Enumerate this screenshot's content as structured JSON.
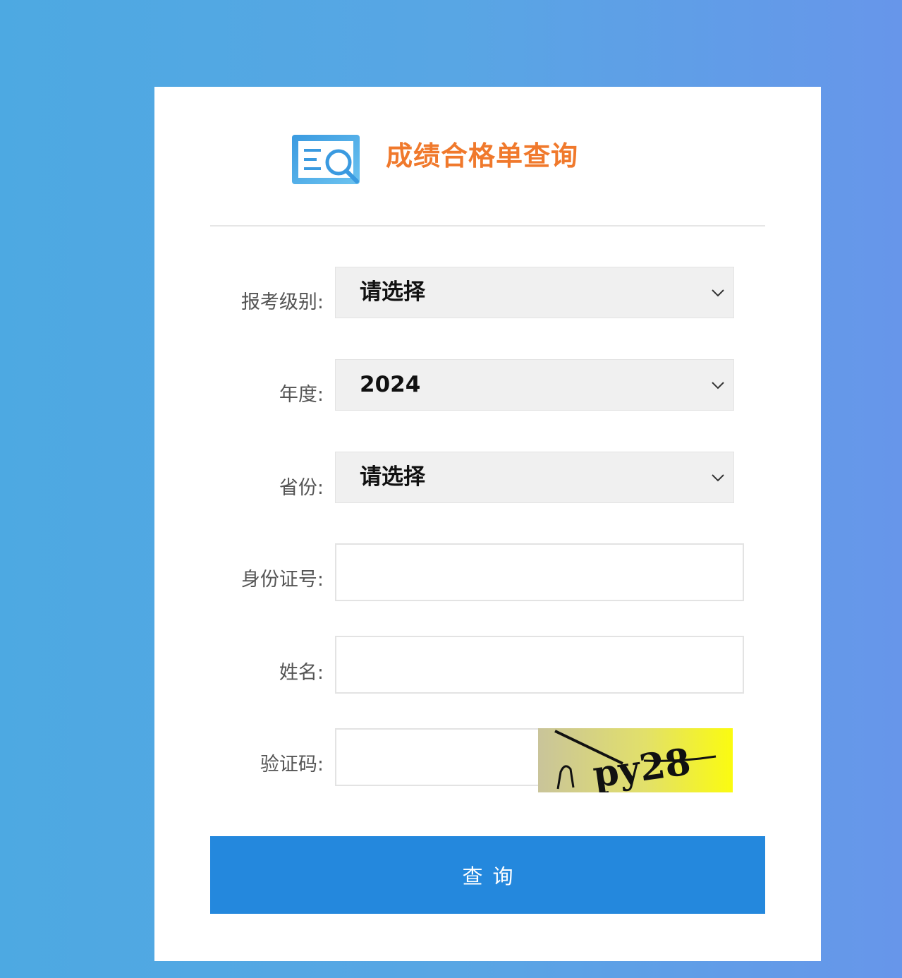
{
  "header": {
    "title": "成绩合格单查询",
    "logo_icon": "document-search-icon",
    "title_color": "#f0792c"
  },
  "form": {
    "level": {
      "label": "报考级别:",
      "value": "请选择",
      "icon": "chevron-down-icon"
    },
    "year": {
      "label": "年度:",
      "value": "2024",
      "icon": "chevron-down-icon"
    },
    "province": {
      "label": "省份:",
      "value": "请选择",
      "icon": "chevron-down-icon"
    },
    "id_number": {
      "label": "身份证号:",
      "value": "",
      "placeholder": ""
    },
    "name": {
      "label": "姓名:",
      "value": "",
      "placeholder": ""
    },
    "captcha": {
      "label": "验证码:",
      "value": "",
      "placeholder": "",
      "image_text": "npy28"
    }
  },
  "submit": {
    "label": "查询",
    "color": "#2488dd"
  }
}
